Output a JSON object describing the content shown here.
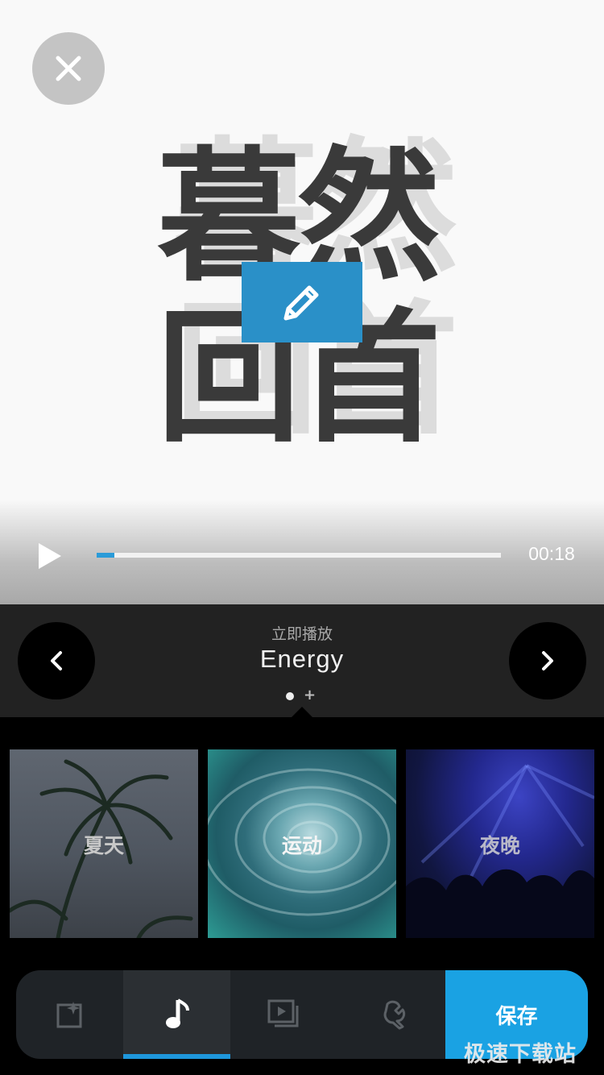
{
  "preview": {
    "title_line1": "暮然",
    "title_line2": "回首",
    "edit_icon": "pencil-icon",
    "close_icon": "close-icon"
  },
  "player": {
    "play_icon": "play-icon",
    "time": "00:18",
    "progress": 0.044
  },
  "theme": {
    "subtitle": "立即播放",
    "name": "Energy",
    "prev_icon": "chevron-left-icon",
    "next_icon": "chevron-right-icon"
  },
  "cards": [
    {
      "label": "夏天"
    },
    {
      "label": "运动"
    },
    {
      "label": "夜晚"
    }
  ],
  "toolbar": {
    "tools": [
      {
        "icon": "sparkle-photo-icon"
      },
      {
        "icon": "music-note-icon"
      },
      {
        "icon": "video-layers-icon"
      },
      {
        "icon": "wrench-icon"
      }
    ],
    "save_label": "保存"
  },
  "watermark": "极速下载站",
  "colors": {
    "accent": "#1aa2e3",
    "edit_button": "#2a90c8",
    "progress": "#2a9bd8"
  }
}
